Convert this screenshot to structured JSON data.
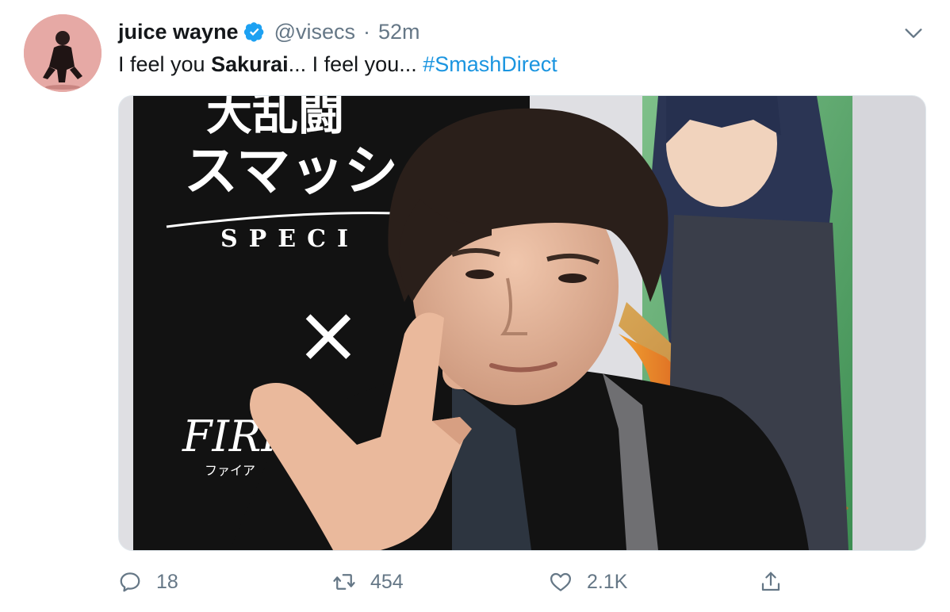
{
  "tweet": {
    "author": {
      "display_name": "juice wayne",
      "handle": "@visecs",
      "verified": true
    },
    "separator": "·",
    "time": "52m",
    "text_parts": {
      "part1": "I feel you ",
      "bold": "Sakurai",
      "part2": "... I feel you... ",
      "hashtag": "#SmashDirect"
    },
    "media": {
      "type": "video-still",
      "visible_text": {
        "logo_line1": "大乱闘",
        "logo_line2": "スマッシュブラ",
        "special": "SPECI",
        "cross": "×",
        "fire_emblem": "FIRE",
        "fire_emblem_kana": "ファイア"
      }
    },
    "actions": {
      "reply_count": "18",
      "retweet_count": "454",
      "like_count": "2.1K"
    }
  },
  "colors": {
    "accent": "#1b95e0",
    "muted": "#657786",
    "text": "#14171a",
    "verified": "#1da1f2"
  },
  "icons": [
    "chevron-down-icon",
    "verified-badge-icon",
    "reply-icon",
    "retweet-icon",
    "like-icon",
    "share-icon"
  ]
}
